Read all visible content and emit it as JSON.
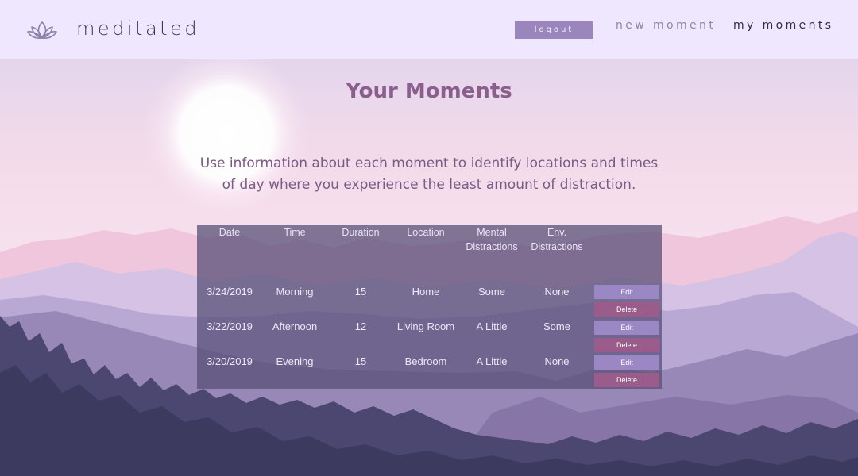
{
  "header": {
    "brand": "meditated",
    "logout_label": "logout",
    "nav": {
      "new_moment": "new moment",
      "my_moments": "my moments"
    }
  },
  "main": {
    "title": "Your Moments",
    "intro_line1": "Use information about each moment to identify locations and times",
    "intro_line2": "of day where you experience the least amount of distraction."
  },
  "table": {
    "headers": {
      "date": "Date",
      "time": "Time",
      "duration": "Duration",
      "location": "Location",
      "mental_1": "Mental",
      "mental_2": "Distractions",
      "env_1": "Env.",
      "env_2": "Distractions"
    },
    "edit_label": "Edit",
    "delete_label": "Delete",
    "rows": [
      {
        "date": "3/24/2019",
        "time": "Morning",
        "duration": "15",
        "location": "Home",
        "mental": "Some",
        "env": "None"
      },
      {
        "date": "3/22/2019",
        "time": "Afternoon",
        "duration": "12",
        "location": "Living Room",
        "mental": "A Little",
        "env": "Some"
      },
      {
        "date": "3/20/2019",
        "time": "Evening",
        "duration": "15",
        "location": "Bedroom",
        "mental": "A Little",
        "env": "None"
      }
    ]
  },
  "colors": {
    "header_bg": "#efe7fd",
    "accent_purple": "#9b85bd",
    "title": "#8a5f8e",
    "delete": "#9a5d8b",
    "edit": "#9a87c4"
  }
}
